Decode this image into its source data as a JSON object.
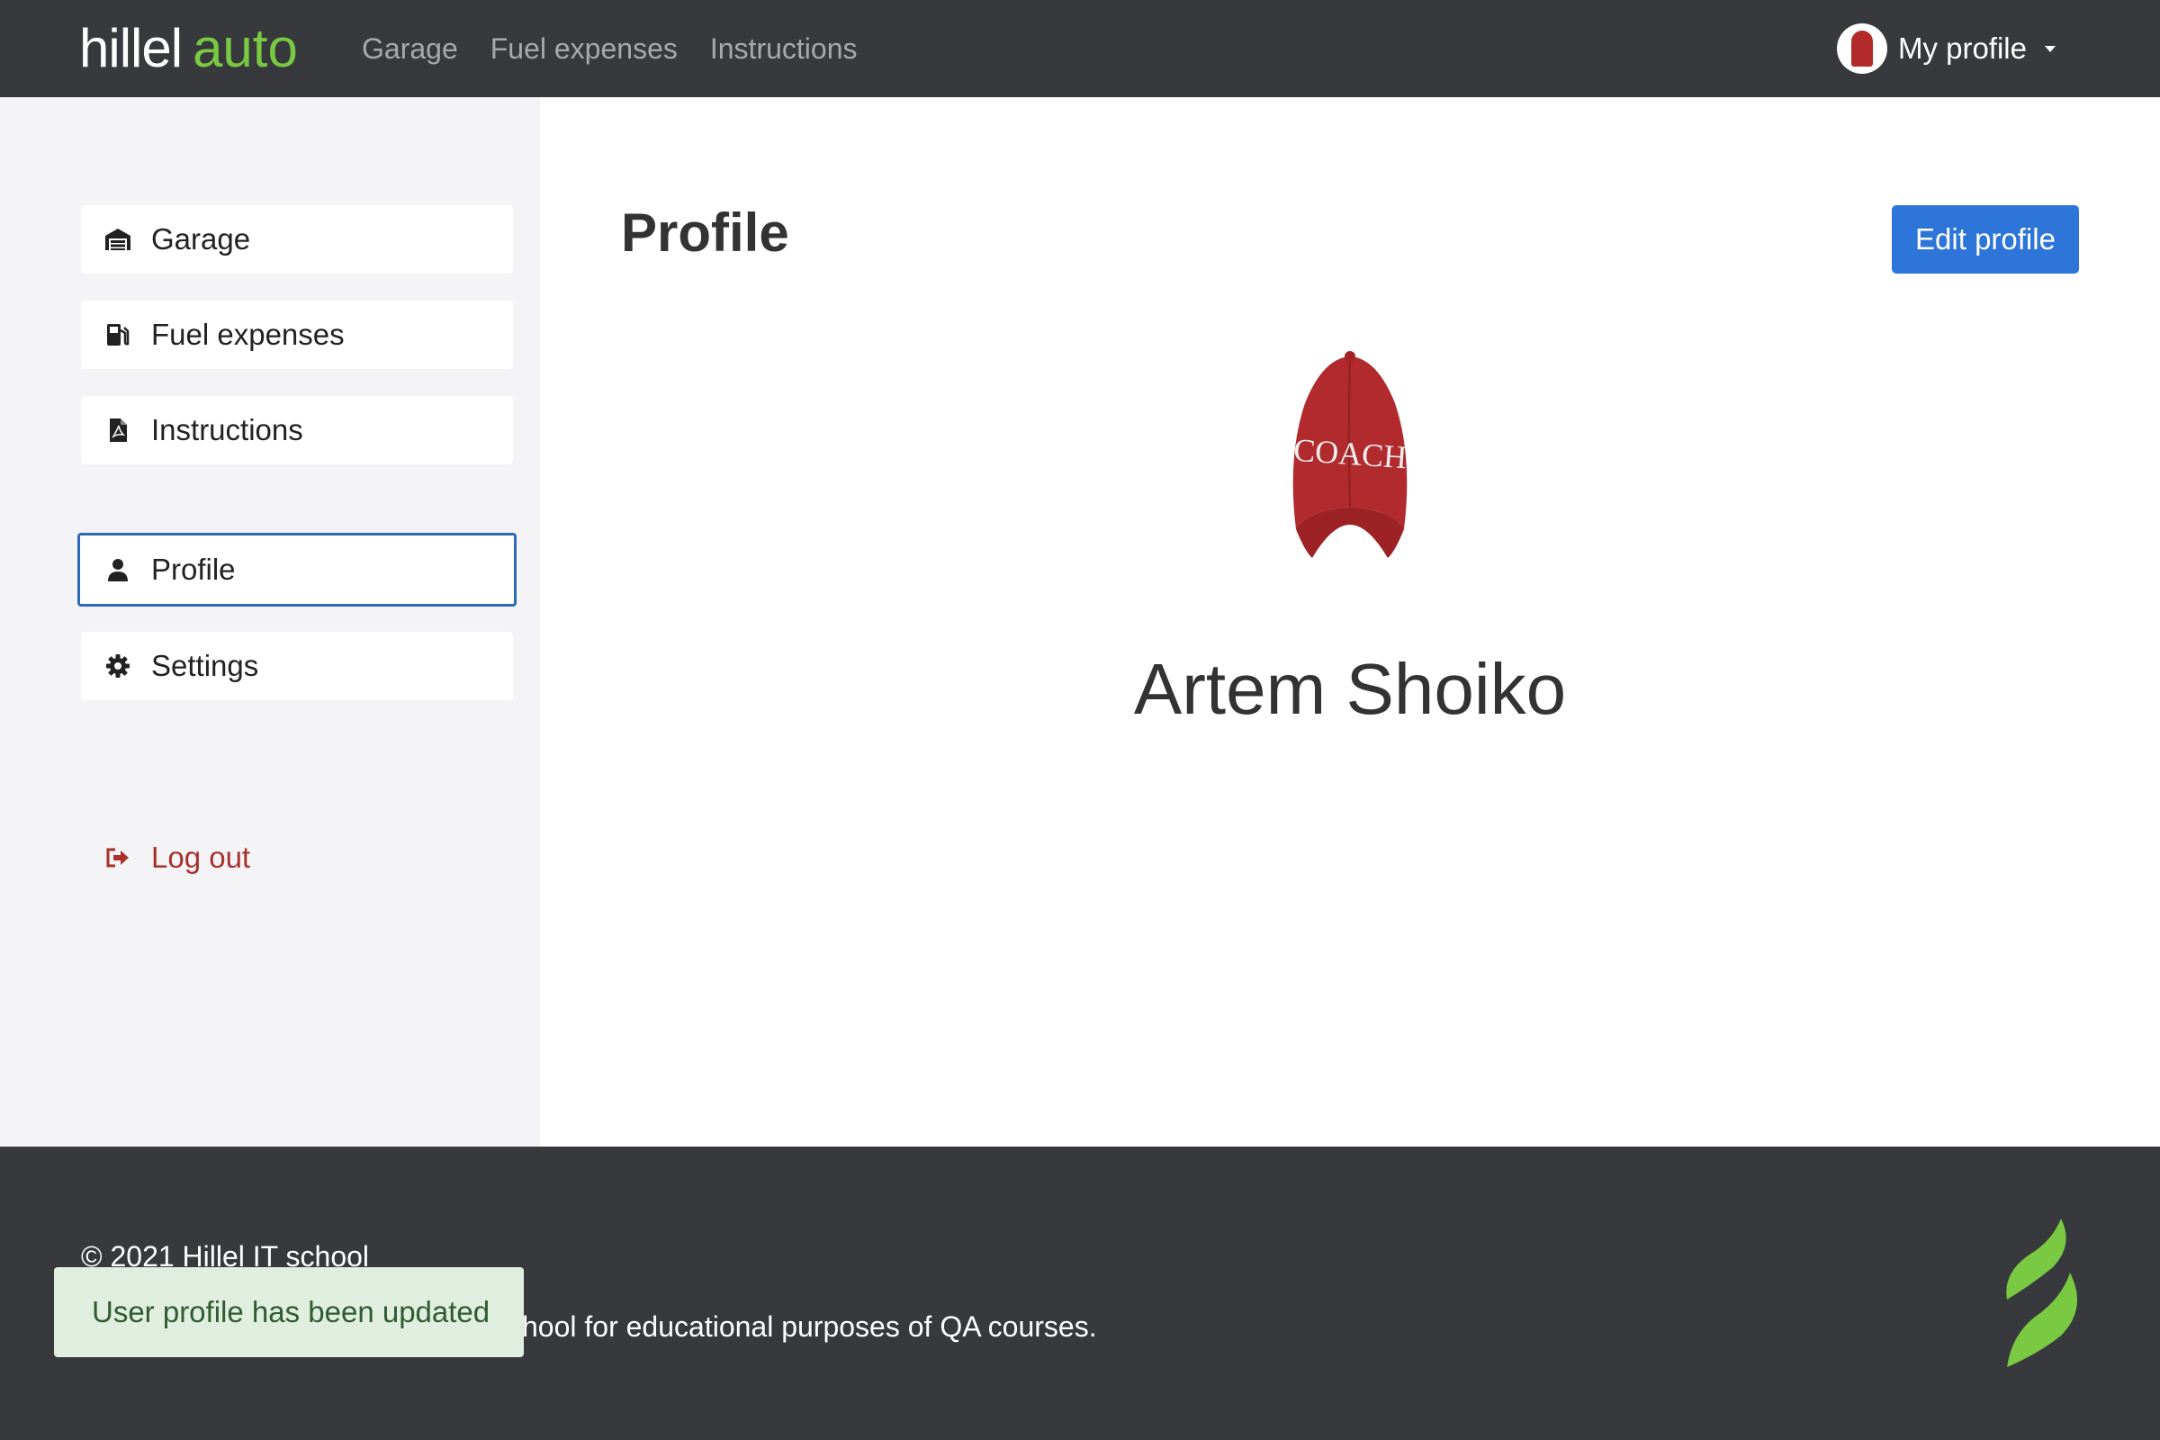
{
  "header": {
    "logo_part1": "hillel",
    "logo_part2": "auto",
    "nav": [
      {
        "label": "Garage"
      },
      {
        "label": "Fuel expenses"
      },
      {
        "label": "Instructions"
      }
    ],
    "profile_menu_label": "My profile"
  },
  "sidebar": {
    "items": [
      {
        "label": "Garage",
        "icon": "garage-icon"
      },
      {
        "label": "Fuel expenses",
        "icon": "fuel-icon"
      },
      {
        "label": "Instructions",
        "icon": "pdf-file-icon"
      },
      {
        "label": "Profile",
        "icon": "user-icon",
        "active": true
      },
      {
        "label": "Settings",
        "icon": "gear-icon"
      }
    ],
    "logout_label": "Log out"
  },
  "main": {
    "title": "Profile",
    "edit_button": "Edit profile",
    "user_name": "Artem Shoiko",
    "avatar_text": "COACH"
  },
  "footer": {
    "copyright": "© 2021 Hillel IT school",
    "note": "hool for educational purposes of QA courses."
  },
  "toast": {
    "message": "User profile has been updated"
  },
  "colors": {
    "header_bg": "#37393c",
    "accent_green": "#7ac943",
    "primary_blue": "#2e75d9",
    "logout_red": "#a8312c",
    "toast_bg": "#dfeede"
  }
}
